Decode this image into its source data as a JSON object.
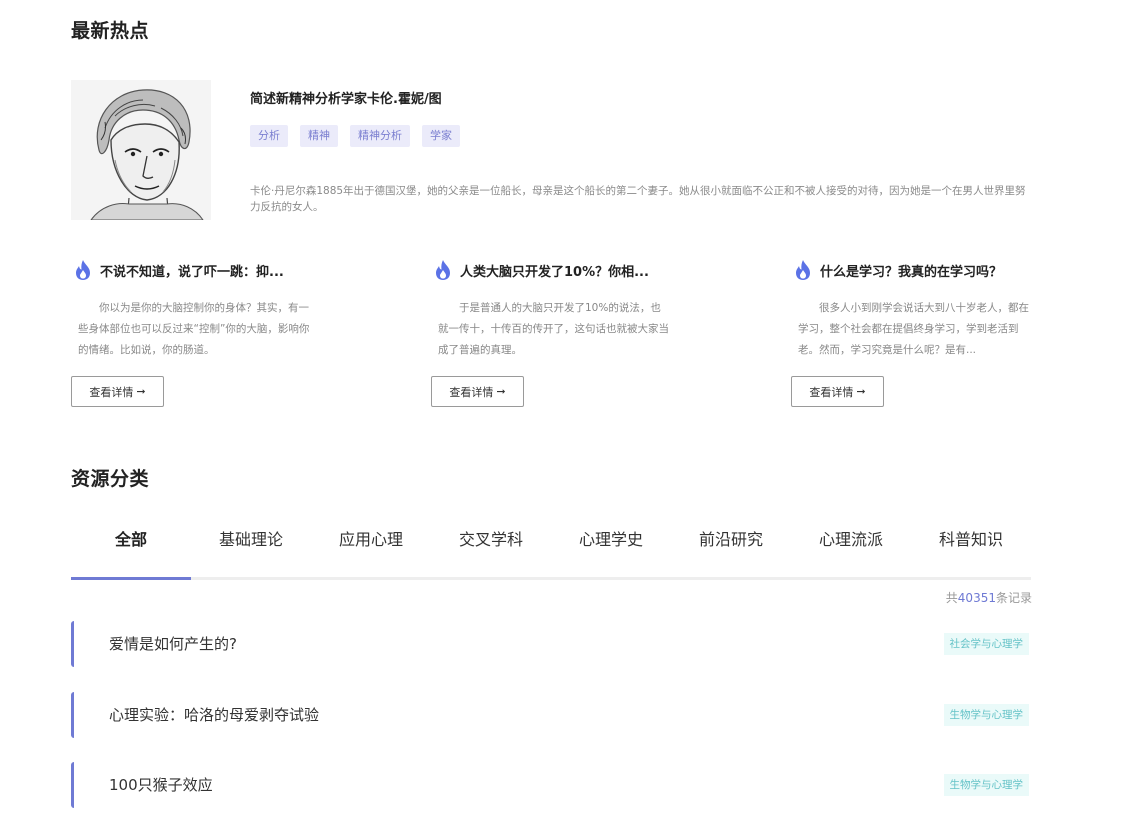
{
  "hot": {
    "title": "最新热点",
    "featured": {
      "title": "简述新精神分析学家卡伦.霍妮/图",
      "tags": [
        "分析",
        "精神",
        "精神分析",
        "学家"
      ],
      "desc": "卡伦·丹尼尔森1885年出于德国汉堡，她的父亲是一位船长，母亲是这个船长的第二个妻子。她从很小就面临不公正和不被人接受的对待，因为她是一个在男人世界里努力反抗的女人。"
    },
    "cards": [
      {
        "title": "不说不知道，说了吓一跳：抑...",
        "body": "你以为是你的大脑控制你的身体？其实，有一些身体部位也可以反过来“控制”你的大脑，影响你的情绪。比如说，你的肠道。",
        "button": "查看详情"
      },
      {
        "title": "人类大脑只开发了10%？你相...",
        "body": "于是普通人的大脑只开发了10%的说法，也就一传十，十传百的传开了，这句话也就被大家当成了普遍的真理。",
        "button": "查看详情"
      },
      {
        "title": "什么是学习？我真的在学习吗？",
        "body": "很多人小到刚学会说话大到八十岁老人，都在学习，整个社会都在提倡终身学习，学到老活到老。然而，学习究竟是什么呢？是有...",
        "button": "查看详情"
      }
    ]
  },
  "resources": {
    "title": "资源分类",
    "tabs": [
      "全部",
      "基础理论",
      "应用心理",
      "交叉学科",
      "心理学史",
      "前沿研究",
      "心理流派",
      "科普知识"
    ],
    "active_tab": "全部",
    "count_prefix": "共",
    "count": "40351",
    "count_suffix": "条记录",
    "items": [
      {
        "title": "爱情是如何产生的?",
        "tag": "社会学与心理学"
      },
      {
        "title": "心理实验：哈洛的母爱剥夺试验",
        "tag": "生物学与心理学"
      },
      {
        "title": "100只猴子效应",
        "tag": "生物学与心理学"
      }
    ]
  },
  "colors": {
    "accent": "#6f7ad4",
    "tag_bg": "#ebebfa",
    "tag_text": "#7b7fd0",
    "res_tag_bg": "#eafaf9",
    "res_tag_text": "#66c3c8"
  },
  "icons": {
    "flame": "flame-icon",
    "arrow": "arrow-right-icon"
  }
}
